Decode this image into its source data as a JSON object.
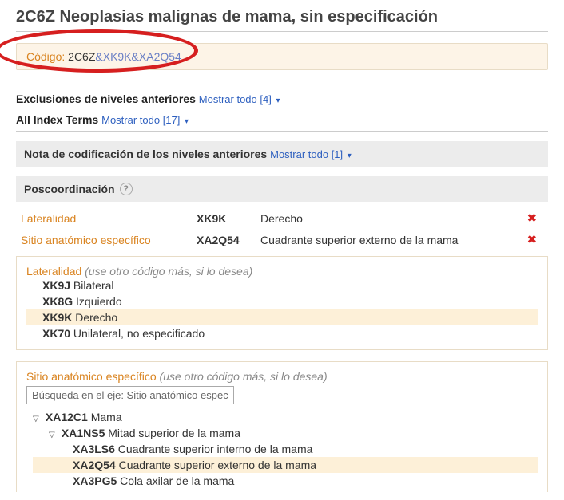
{
  "title": "2C6Z Neoplasias malignas de mama, sin especificación",
  "codebox": {
    "label": "Código:",
    "main": "2C6Z",
    "amp": "&",
    "ext1": "XK9K",
    "ext2": "XA2Q54"
  },
  "exclusions": {
    "label": "Exclusiones de niveles anteriores",
    "action": "Mostrar todo [4]"
  },
  "indexTerms": {
    "label": "All Index Terms",
    "action": "Mostrar todo [17]"
  },
  "codingNote": {
    "label": "Nota de codificación de los niveles anteriores",
    "action": "Mostrar todo [1]"
  },
  "postcoord": {
    "header": "Poscoordinación",
    "rows": [
      {
        "axis": "Lateralidad",
        "code": "XK9K",
        "desc": "Derecho"
      },
      {
        "axis": "Sitio anatómico específico",
        "code": "XA2Q54",
        "desc": "Cuadrante superior externo de la mama"
      }
    ]
  },
  "panelLat": {
    "title": "Lateralidad",
    "hint": "(use otro código más, si lo desea)",
    "options": [
      {
        "code": "XK9J",
        "desc": "Bilateral",
        "selected": false
      },
      {
        "code": "XK8G",
        "desc": "Izquierdo",
        "selected": false
      },
      {
        "code": "XK9K",
        "desc": "Derecho",
        "selected": true
      },
      {
        "code": "XK70",
        "desc": "Unilateral, no especificado",
        "selected": false
      }
    ]
  },
  "panelSite": {
    "title": "Sitio anatómico específico",
    "hint": "(use otro código más, si lo desea)",
    "searchPlaceholder": "Búsqueda en el eje: Sitio anatómico específi",
    "tree": {
      "root": {
        "code": "XA12C1",
        "desc": "Mama"
      },
      "child": {
        "code": "XA1NS5",
        "desc": "Mitad superior de la mama"
      },
      "leaves": [
        {
          "code": "XA3LS6",
          "desc": "Cuadrante superior interno de la mama",
          "selected": false
        },
        {
          "code": "XA2Q54",
          "desc": "Cuadrante superior externo de la mama",
          "selected": true
        },
        {
          "code": "XA3PG5",
          "desc": "Cola axilar de la mama",
          "selected": false
        }
      ]
    }
  }
}
